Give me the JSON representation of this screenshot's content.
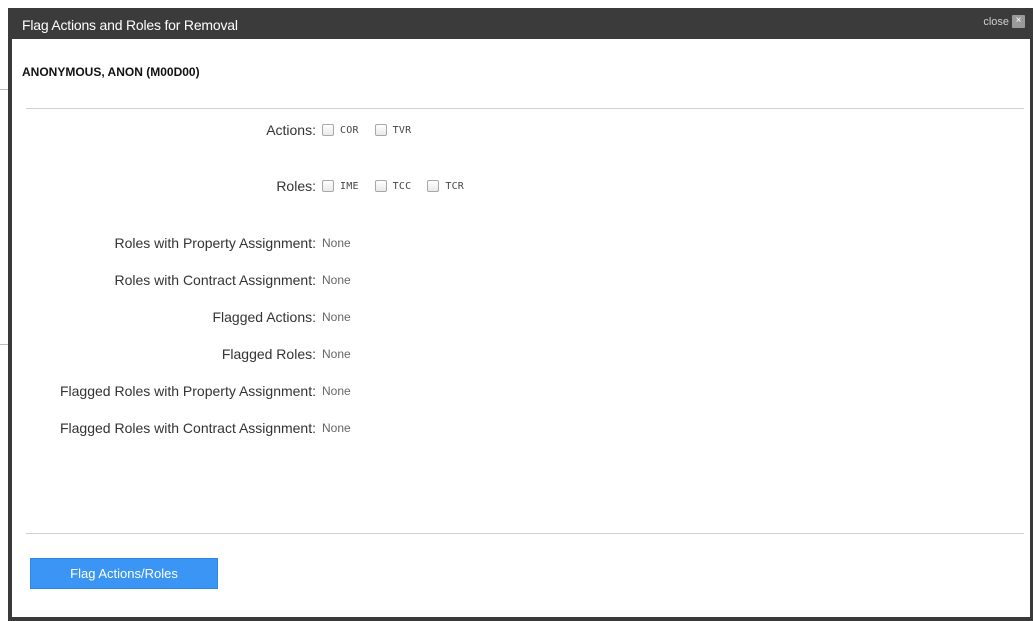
{
  "dialog": {
    "title": "Flag Actions and Roles for Removal",
    "close_label": "close",
    "close_icon": "×",
    "subject": "ANONYMOUS, ANON (M00D00)"
  },
  "actions": {
    "label": "Actions:",
    "options": [
      {
        "code": "COR",
        "checked": false
      },
      {
        "code": "TVR",
        "checked": false
      }
    ]
  },
  "roles": {
    "label": "Roles:",
    "options": [
      {
        "code": "IME",
        "checked": false
      },
      {
        "code": "TCC",
        "checked": false
      },
      {
        "code": "TCR",
        "checked": false
      }
    ]
  },
  "fields": [
    {
      "label": "Roles with Property Assignment:",
      "value": "None"
    },
    {
      "label": "Roles with Contract Assignment:",
      "value": "None"
    },
    {
      "label": "Flagged Actions:",
      "value": "None"
    },
    {
      "label": "Flagged Roles:",
      "value": "None"
    },
    {
      "label": "Flagged Roles with Property Assignment:",
      "value": "None"
    },
    {
      "label": "Flagged Roles with Contract Assignment:",
      "value": "None"
    }
  ],
  "footer": {
    "submit_label": "Flag Actions/Roles"
  },
  "colors": {
    "titlebar": "#3b3b3b",
    "primary_button": "#3a95f5"
  }
}
